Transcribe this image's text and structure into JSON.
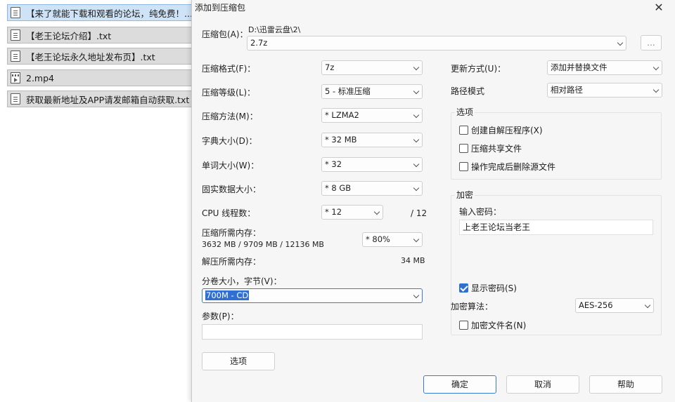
{
  "files": [
    {
      "name": "【来了就能下载和观看的论坛，纯免费！...",
      "icon": "document-icon",
      "selected": true
    },
    {
      "name": "【老王论坛介绍】.txt",
      "icon": "document-icon"
    },
    {
      "name": "【老王论坛永久地址发布页】.txt",
      "icon": "document-icon"
    },
    {
      "name": "2.mp4",
      "icon": "video-file-icon"
    },
    {
      "name": "获取最新地址及APP请发邮箱自动获取.txt",
      "icon": "document-icon"
    }
  ],
  "dialog": {
    "title": "添加到压缩包",
    "close": "✕",
    "archive_label": "压缩包(A)：",
    "archive_path": "D:\\迅雷云盘\\2\\",
    "archive_name": "2.7z",
    "browse_label": "...",
    "format_label": "压缩格式(F)：",
    "format_value": "7z",
    "level_label": "压缩等级(L)：",
    "level_value": "5 - 标准压缩",
    "method_label": "压缩方法(M)：",
    "method_value": "* LZMA2",
    "dict_label": "字典大小(D)：",
    "dict_value": "* 32 MB",
    "word_label": "单词大小(W)：",
    "word_value": "* 32",
    "solid_label": "固实数据大小：",
    "solid_value": "* 8 GB",
    "cpu_label": "CPU 线程数：",
    "cpu_value": "* 12",
    "cpu_total": "/ 12",
    "mem_comp_label": "压缩所需内存：",
    "mem_comp_value": "3632 MB / 9709 MB / 12136 MB",
    "mem_percent": "* 80%",
    "mem_decomp_label": "解压所需内存：",
    "mem_decomp_value": "34 MB",
    "split_label": "分卷大小，字节(V)：",
    "split_value": "700M - CD",
    "params_label": "参数(P)：",
    "params_value": "",
    "options_button": "选项",
    "update_label": "更新方式(U)：",
    "update_value": "添加并替换文件",
    "path_label": "路径模式",
    "path_value": "相对路径",
    "options_group": "选项",
    "opt_sfx": "创建自解压程序(X)",
    "opt_shared": "压缩共享文件",
    "opt_delete": "操作完成后删除源文件",
    "encrypt_group": "加密",
    "password_label": "输入密码：",
    "password_value": "上老王论坛当老王",
    "show_password": "显示密码(S)",
    "enc_method_label": "加密算法：",
    "enc_method_value": "AES-256",
    "encrypt_names": "加密文件名(N)",
    "ok": "确定",
    "cancel": "取消",
    "help": "帮助"
  },
  "colors": {
    "accent": "#2f6fd4",
    "selected_row": "#cfe3f7"
  }
}
